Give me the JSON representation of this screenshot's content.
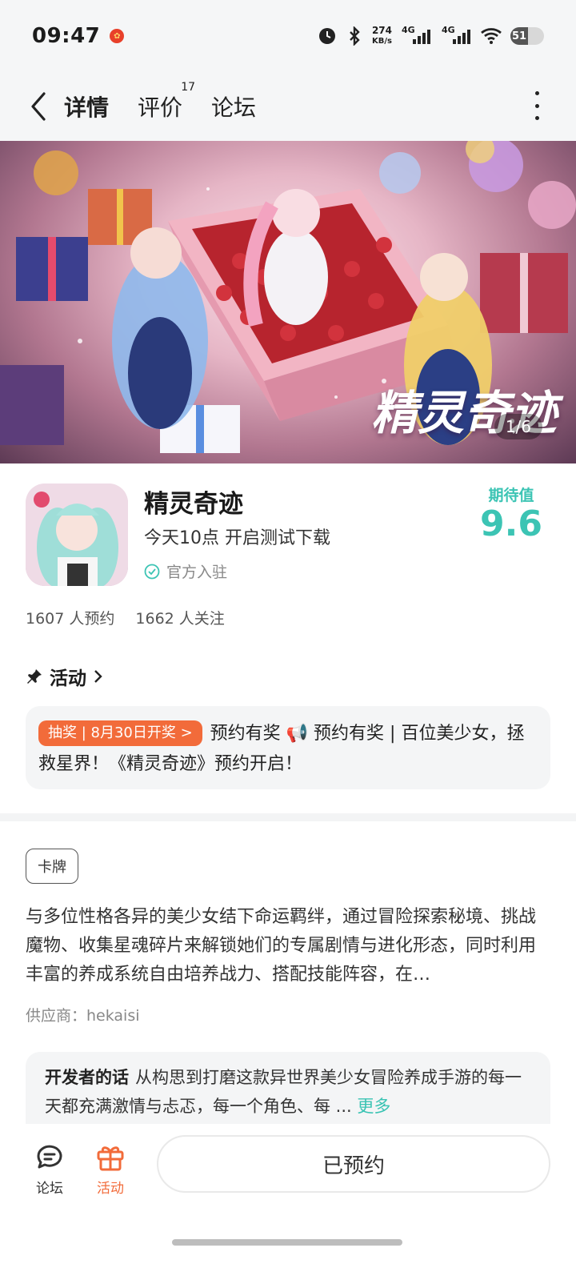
{
  "status": {
    "time": "09:47",
    "net_speed_value": "274",
    "net_speed_unit": "KB/s",
    "signal1": "4G",
    "signal2": "4G",
    "battery": "51"
  },
  "nav": {
    "tabs": [
      {
        "label": "详情",
        "active": true
      },
      {
        "label": "评价",
        "badge": "17"
      },
      {
        "label": "论坛"
      }
    ]
  },
  "banner": {
    "title": "精灵奇迹",
    "pager": "1/6"
  },
  "app": {
    "name": "精灵奇迹",
    "subtitle": "今天10点 开启测试下载",
    "official": "官方入驻",
    "expect_label": "期待值",
    "expect_score": "9.6"
  },
  "stats": {
    "reservations": "1607 人预约",
    "followers": "1662 人关注"
  },
  "activity": {
    "header": "活动",
    "pill": "抽奖 | 8月30日开奖 >",
    "text": "预约有奖 📢 预约有奖 | 百位美少女，拯救星界！《精灵奇迹》预约开启！"
  },
  "tag": "卡牌",
  "description": "与多位性格各异的美少女结下命运羁绊，通过冒险探索秘境、挑战魔物、收集星魂碎片来解锁她们的专属剧情与进化形态，同时利用丰富的养成系统自由培养战力、搭配技能阵容，在…",
  "supplier": "供应商：hekaisi",
  "developer": {
    "title": "开发者的话",
    "text": "从构思到打磨这款异世界美少女冒险养成手游的每一天都充满激情与忐忑，每一个角色、每 ...",
    "more": "更多"
  },
  "bottom": {
    "forum": "论坛",
    "activity": "活动",
    "reserve_button": "已预约"
  },
  "colors": {
    "accent": "#39c6b6",
    "orange": "#f26b3a"
  }
}
